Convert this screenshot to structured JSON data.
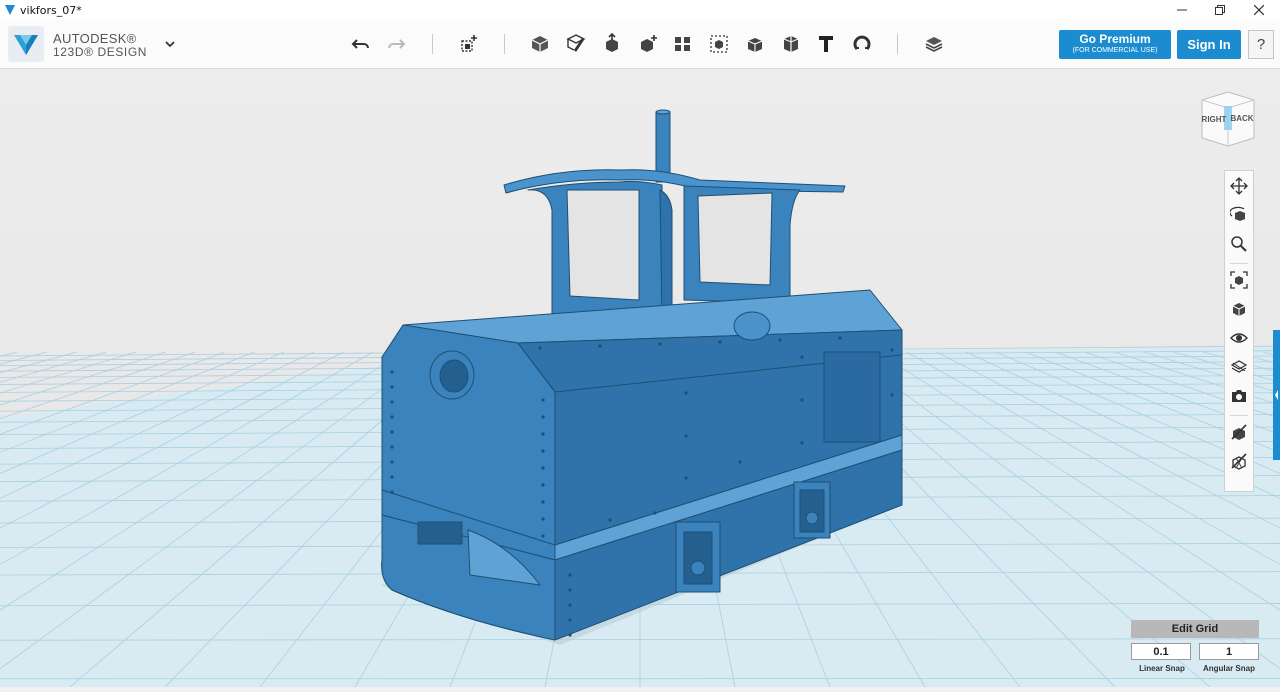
{
  "window": {
    "title": "vikfors_07*",
    "controls": {
      "minimize": "minimize-icon",
      "restore": "restore-icon",
      "close": "close-icon"
    }
  },
  "brand": {
    "line1": "AUTODESK®",
    "line2": "123D® DESIGN",
    "menu_icon": "chevron-down-icon"
  },
  "toolbar": {
    "tools": [
      {
        "id": "undo",
        "icon": "undo-icon"
      },
      {
        "id": "redo",
        "icon": "redo-icon"
      },
      {
        "id": "transform",
        "icon": "transform-icon"
      },
      {
        "id": "primitives",
        "icon": "primitives-icon"
      },
      {
        "id": "sketch",
        "icon": "sketch-icon"
      },
      {
        "id": "construct",
        "icon": "construct-icon"
      },
      {
        "id": "modify",
        "icon": "modify-icon"
      },
      {
        "id": "pattern",
        "icon": "pattern-icon"
      },
      {
        "id": "group",
        "icon": "group-icon"
      },
      {
        "id": "combine",
        "icon": "combine-icon"
      },
      {
        "id": "measure",
        "icon": "measure-icon"
      },
      {
        "id": "text",
        "icon": "text-icon"
      },
      {
        "id": "snap",
        "icon": "snap-icon"
      },
      {
        "id": "material",
        "icon": "material-icon"
      }
    ],
    "premium_label": "Go Premium",
    "premium_sub": "(FOR COMMERCIAL USE)",
    "signin_label": "Sign In",
    "help_label": "?"
  },
  "viewcube": {
    "right": "RIGHT",
    "back": "BACK"
  },
  "navbar": {
    "items": [
      {
        "id": "pan",
        "icon": "pan-icon"
      },
      {
        "id": "orbit",
        "icon": "orbit-icon"
      },
      {
        "id": "zoom",
        "icon": "zoom-icon"
      },
      {
        "id": "fit",
        "icon": "fit-icon"
      },
      {
        "id": "views",
        "icon": "views-icon"
      },
      {
        "id": "visibility",
        "icon": "eye-icon"
      },
      {
        "id": "materials",
        "icon": "material-outline-icon"
      },
      {
        "id": "screenshot",
        "icon": "camera-icon"
      },
      {
        "id": "hide-sketch",
        "icon": "hide-sketch-icon"
      },
      {
        "id": "hide-mesh",
        "icon": "hide-mesh-icon"
      }
    ]
  },
  "grid": {
    "edit_label": "Edit Grid",
    "linear_value": "0.1",
    "angular_value": "1",
    "linear_label": "Linear Snap",
    "angular_label": "Angular Snap"
  },
  "colors": {
    "accent": "#1a8ccf",
    "model": "#3a83bd",
    "grid_fill": "#d8ebf3",
    "grid_line": "#a9cfe0"
  }
}
